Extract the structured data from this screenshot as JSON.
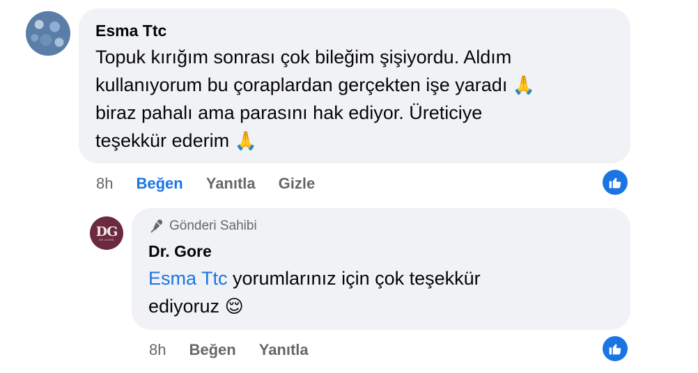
{
  "comment": {
    "author": "Esma Ttc",
    "text_line1": "Topuk kırığım sonrası çok bileğim şişiyordu. Aldım",
    "text_line2": "kullanıyorum bu çoraplardan gerçekten işe yaradı",
    "text_line3": "biraz pahalı ama parasını hak ediyor. Üreticiye",
    "text_line4": "teşekkür ederim",
    "emoji_pray": "🙏",
    "time": "8h",
    "like_label": "Beğen",
    "reply_label": "Yanıtla",
    "hide_label": "Gizle",
    "like_reaction_icon": "thumbs-up-icon"
  },
  "reply": {
    "badge": "Gönderi Sahibi",
    "author": "Dr. Gore",
    "avatar_initials": "DG",
    "avatar_sub": "DR.GORE",
    "mention": "Esma Ttc",
    "text_rest": " yorumlarınız için çok teşekkür",
    "text_line2": "ediyoruz",
    "emoji_relieved": "😌",
    "time": "8h",
    "like_label": "Beğen",
    "reply_label": "Yanıtla",
    "like_reaction_icon": "thumbs-up-icon"
  },
  "colors": {
    "accent": "#1b74e4",
    "bubble": "#f0f2f5",
    "muted": "#65676b"
  }
}
